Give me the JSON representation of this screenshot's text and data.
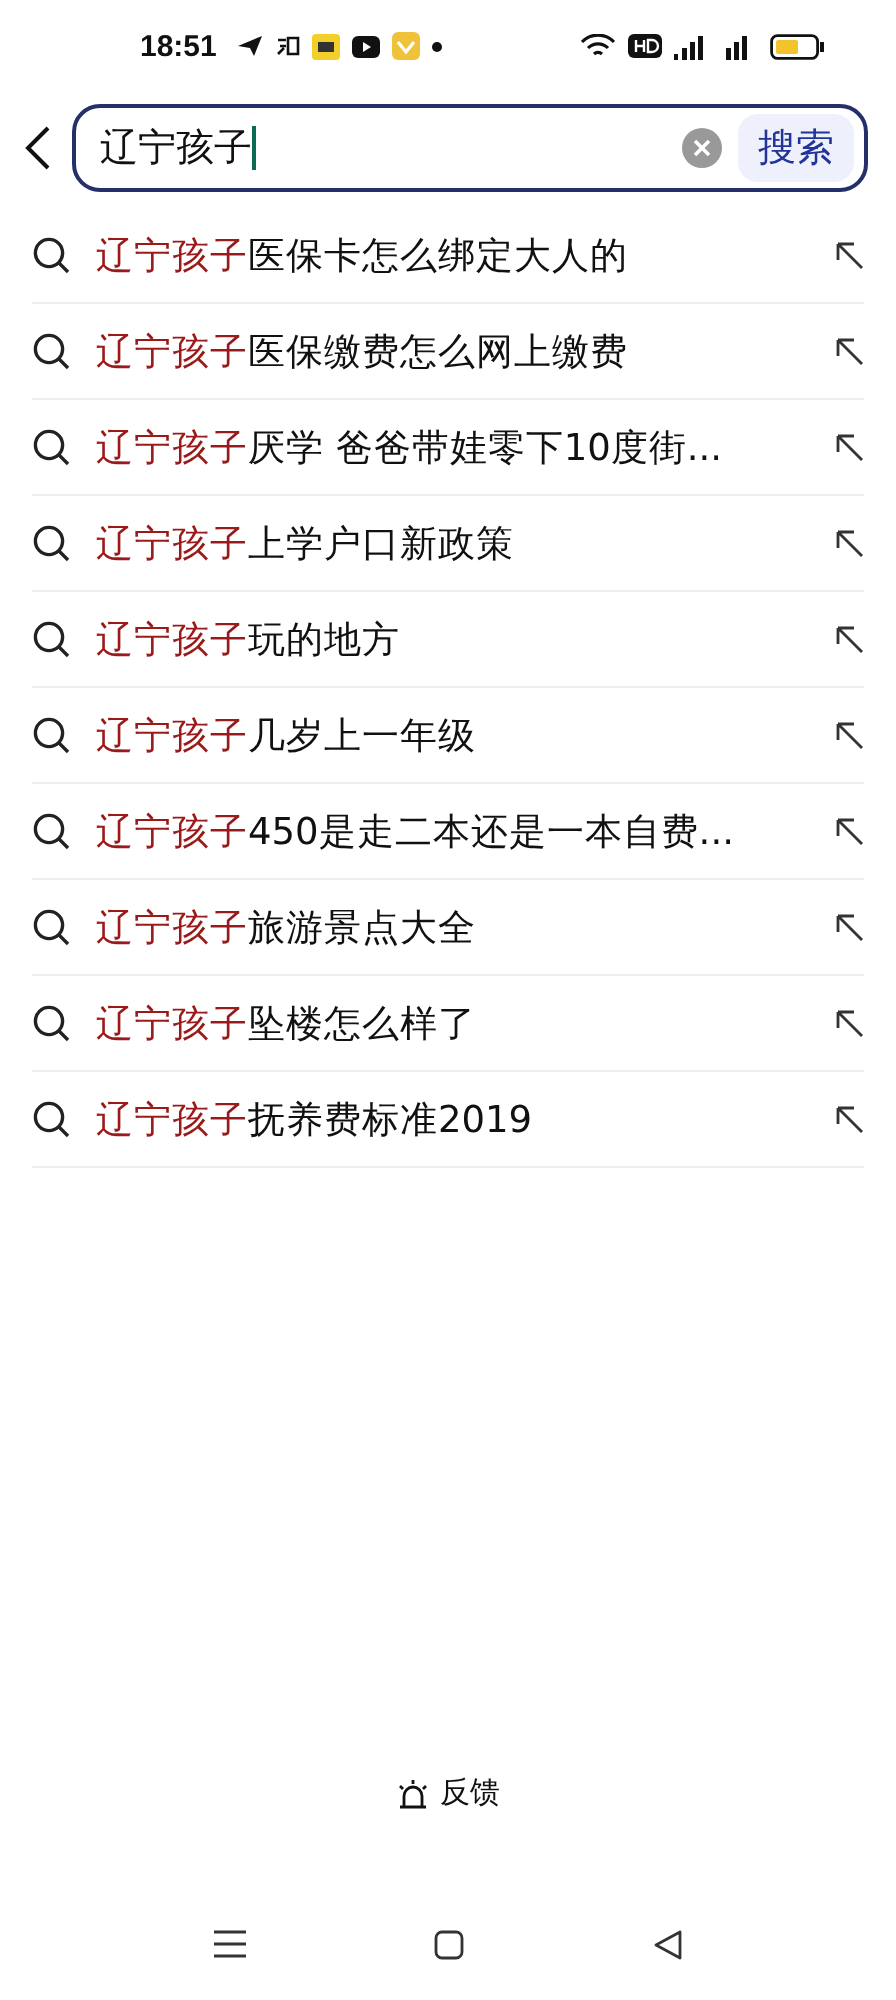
{
  "status_bar": {
    "time": "18:51"
  },
  "search": {
    "value": "辽宁孩子",
    "button": "搜索"
  },
  "suggestions": [
    {
      "match": "辽宁孩子",
      "rest": "医保卡怎么绑定大人的"
    },
    {
      "match": "辽宁孩子",
      "rest": "医保缴费怎么网上缴费"
    },
    {
      "match": "辽宁孩子",
      "rest": "厌学 爸爸带娃零下10度街..."
    },
    {
      "match": "辽宁孩子",
      "rest": "上学户口新政策"
    },
    {
      "match": "辽宁孩子",
      "rest": "玩的地方"
    },
    {
      "match": "辽宁孩子",
      "rest": "几岁上一年级"
    },
    {
      "match": "辽宁孩子",
      "rest": "450是走二本还是一本自费..."
    },
    {
      "match": "辽宁孩子",
      "rest": "旅游景点大全"
    },
    {
      "match": "辽宁孩子",
      "rest": "坠楼怎么样了"
    },
    {
      "match": "辽宁孩子",
      "rest": "抚养费标准2019"
    }
  ],
  "feedback": "反馈"
}
